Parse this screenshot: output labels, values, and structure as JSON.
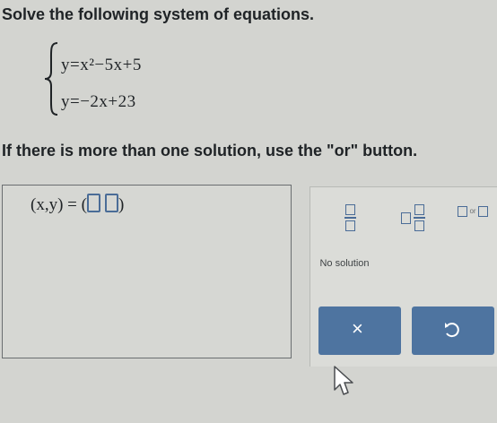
{
  "question": {
    "title": "Solve the following system of equations.",
    "equation_1": "y=x²−5x+5",
    "equation_2": "y=−2x+23",
    "instruction": "If there is more than one solution, use the \"or\" button."
  },
  "answer": {
    "prefix": "(x,y) =",
    "open_paren": "(",
    "close_paren": ")"
  },
  "keypad": {
    "or_label": "or",
    "no_solution_label": "No solution"
  },
  "actions": {
    "clear_symbol": "×"
  },
  "icons": {
    "clear": "close-icon",
    "undo": "undo-icon",
    "cursor": "mouse-pointer-icon"
  },
  "colors": {
    "accent": "#4e74a0",
    "slot_border": "#4a6c97",
    "background": "#d3d4d0"
  }
}
